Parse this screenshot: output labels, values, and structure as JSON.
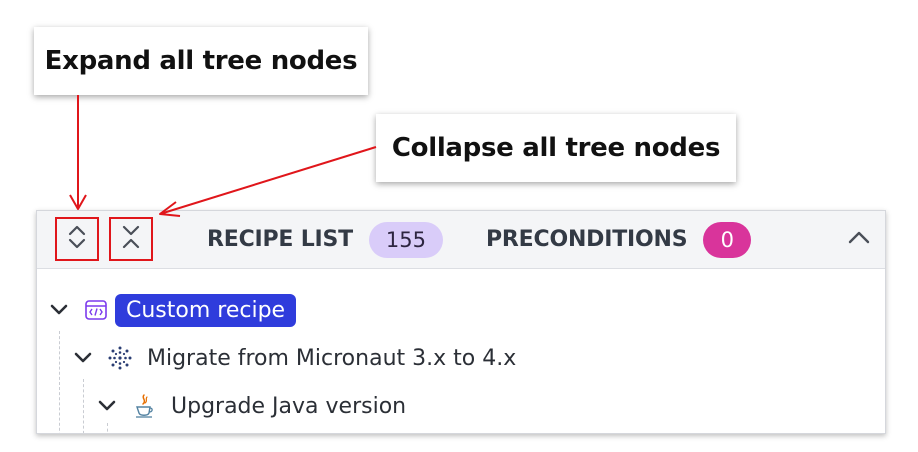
{
  "callouts": {
    "expand": "Expand all tree nodes",
    "collapse": "Collapse all tree nodes"
  },
  "panel": {
    "tabs": [
      {
        "label": "RECIPE LIST",
        "count": "155",
        "badge_color": "#d9ccf9"
      },
      {
        "label": "PRECONDITIONS",
        "count": "0",
        "badge_color": "#d9349b"
      }
    ],
    "toolbar_icons": [
      "expand-all-icon",
      "collapse-all-icon"
    ],
    "toggle_icon": "chevron-up-icon"
  },
  "tree": [
    {
      "label": "Custom recipe",
      "icon": "code-window-icon",
      "selected": true,
      "expanded": true
    },
    {
      "label": "Migrate from Micronaut 3.x to 4.x",
      "icon": "micronaut-icon",
      "selected": false,
      "expanded": true
    },
    {
      "label": "Upgrade Java version",
      "icon": "java-icon",
      "selected": false,
      "expanded": true
    }
  ],
  "colors": {
    "annotation_red": "#e0161b",
    "selected_node": "#2f3cdc"
  }
}
